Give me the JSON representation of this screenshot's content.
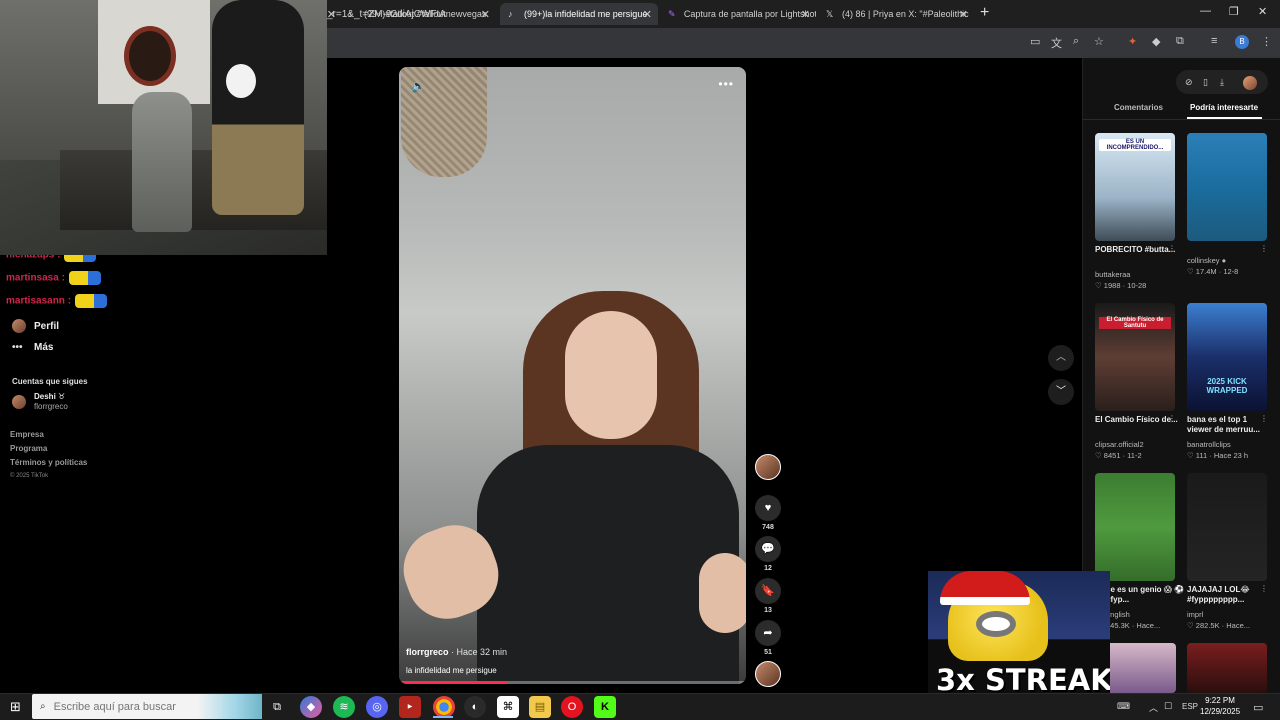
{
  "browser": {
    "tabs": [
      {
        "icon": "tiktok-icon",
        "title": "(99+)#fallout #falloutnewvegas",
        "active": false
      },
      {
        "icon": "tiktok-icon",
        "title": "(99+)la infidelidad me persigue",
        "active": true
      },
      {
        "icon": "lightshot-icon",
        "title": "Captura de pantalla por Lightshot",
        "active": false
      },
      {
        "icon": "x-icon",
        "title": "(4) 86 | Priya en X: \"#Paleolithic",
        "active": false
      }
    ],
    "url": "_r=1&_t=ZM-92diAjCWFtA"
  },
  "left_nav": {
    "chat_lines": [
      {
        "user": "nicnazaps",
        "sep": ":"
      },
      {
        "user": "martinsasa",
        "sep": ":"
      },
      {
        "user": "martisasann",
        "sep": ":"
      }
    ],
    "items": [
      {
        "label": "Perfil",
        "icon": "avatar"
      },
      {
        "label": "Más",
        "icon": "more-icon"
      }
    ],
    "following_title": "Cuentas que sigues",
    "following": [
      {
        "name": "Deshi ♉",
        "handle": "florrgreco"
      }
    ],
    "footer_links": [
      "Empresa",
      "Programa",
      "Términos y políticas"
    ],
    "copyright": "© 2025 TikTok"
  },
  "video": {
    "author": "florrgreco",
    "time": "· Hace 32 min",
    "caption": "la infidelidad me persigue",
    "progress": 0.31
  },
  "actions": {
    "likes": "748",
    "comments": "12",
    "saves": "13",
    "shares": "51"
  },
  "right_panel": {
    "tabs": [
      "Comentarios",
      "Podría interesarte"
    ],
    "active_tab": "Podría interesarte",
    "cards": [
      {
        "title": "POBRECITO #butta...",
        "author": "buttakeraa",
        "stats": "♡ 1988 · 10-28",
        "thumb_text": "ES UN INCOMPRENDIDO..."
      },
      {
        "title": "",
        "author": "collinskey ●",
        "stats": "♡ 17.4M · 12-8",
        "thumb_text": ""
      },
      {
        "title": "El Cambio Físico de...",
        "author": "clipsar.official2",
        "stats": "♡ 8451 · 11-2",
        "thumb_text": "El Cambio Físico de Santutu"
      },
      {
        "title": "bana es el top 1 viewer de merruu...",
        "author": "banatrollclips",
        "stats": "♡ 111 · Hace 23 h",
        "thumb_text": "2025 KICK WRAPPED"
      },
      {
        "title": "ce es un genio 😱 ⚽ #fyp...",
        "author": "english",
        "stats": "245.3K · Hace...",
        "thumb_text": ""
      },
      {
        "title": "JAJAJAJ LOL😂 #fypppppppp...",
        "author": "imprl",
        "stats": "♡ 282.5K · Hace...",
        "thumb_text": ""
      }
    ]
  },
  "overlay": {
    "streak_text": "3x STREAK"
  },
  "taskbar": {
    "search_placeholder": "Escribe aquí para buscar",
    "language": "ESP",
    "time": "9:22 PM",
    "date": "12/29/2025"
  }
}
